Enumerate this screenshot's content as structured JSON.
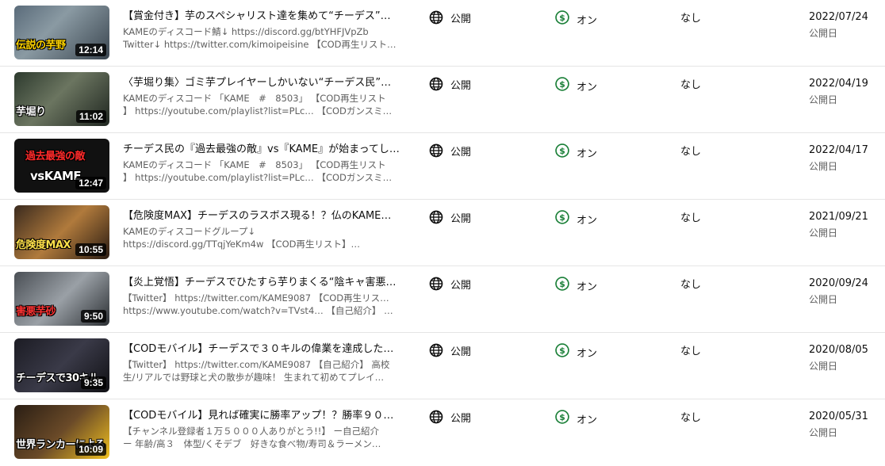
{
  "colors": {
    "monetize_green": "#1a7f37",
    "text_secondary": "#606060",
    "divider": "#e5e5e5"
  },
  "videos": [
    {
      "thumb_caption": "伝説の芋野",
      "duration": "12:14",
      "title": "【賞金付き】芋のスペシャリスト達を集めて“チーデス”を…",
      "desc1": "KAMEのディスコード鯖↓ https://discord.gg/btYHFJVpZb",
      "desc2": "Twitter↓ https://twitter.com/kimoipeisine 【COD再生リスト…",
      "visibility": "公開",
      "visibility_icon": "globe-icon",
      "monetization": "オン",
      "monetization_icon": "dollar-circle-icon",
      "restrictions": "なし",
      "date": "2022/07/24",
      "date_label": "公開日"
    },
    {
      "thumb_caption": "芋堀り",
      "duration": "11:02",
      "title": "〈芋堀り集〉ゴミ芋プレイヤーしかいない“チーデス民”を…",
      "desc1": "KAMEのディスコード 「KAME　#　8503」 【COD再生リスト",
      "desc2": "】 https://youtube.com/playlist?list=PLc… 【CODガンスミ…",
      "visibility": "公開",
      "visibility_icon": "globe-icon",
      "monetization": "オン",
      "monetization_icon": "dollar-circle-icon",
      "restrictions": "なし",
      "date": "2022/04/19",
      "date_label": "公開日"
    },
    {
      "thumb_caption": "過去最強の敵",
      "thumb_caption2": "vsKAME",
      "duration": "12:47",
      "title": "チーデス民の『過去最強の敵』vs『KAME』が始まってし…",
      "desc1": "KAMEのディスコード 「KAME　#　8503」 【COD再生リスト",
      "desc2": "】 https://youtube.com/playlist?list=PLc… 【CODガンスミ…",
      "visibility": "公開",
      "visibility_icon": "globe-icon",
      "monetization": "オン",
      "monetization_icon": "dollar-circle-icon",
      "restrictions": "なし",
      "date": "2022/04/17",
      "date_label": "公開日"
    },
    {
      "thumb_caption": "危険度MAX",
      "duration": "10:55",
      "title": "【危険度MAX】チーデスのラスボス現る！？仏のKAMEを…",
      "desc1": "KAMEのディスコードグループ↓",
      "desc2": "https://discord.gg/TTqjYeKm4w 【COD再生リスト】…",
      "visibility": "公開",
      "visibility_icon": "globe-icon",
      "monetization": "オン",
      "monetization_icon": "dollar-circle-icon",
      "restrictions": "なし",
      "date": "2021/09/21",
      "date_label": "公開日"
    },
    {
      "thumb_caption": "害悪芋砂",
      "duration": "9:50",
      "title": "【炎上覚悟】チーデスでひたすら芋りまくる“陰キャ害悪…",
      "desc1": "【Twitter】 https://twitter.com/KAME9087 【COD再生リスト】",
      "desc2": "https://www.youtube.com/watch?v=TVst4… 【自己紹介】 高…",
      "visibility": "公開",
      "visibility_icon": "globe-icon",
      "monetization": "オン",
      "monetization_icon": "dollar-circle-icon",
      "restrictions": "なし",
      "date": "2020/09/24",
      "date_label": "公開日"
    },
    {
      "thumb_caption": "チーデスで30キル",
      "duration": "9:35",
      "title": "【CODモバイル】チーデスで３０キルの偉業を達成した…",
      "desc1": "【Twitter】 https://twitter.com/KAME9087 【自己紹介】 高校",
      "desc2": "生/リアルでは野球と犬の散歩が趣味！ 生まれて初めてプレイ…",
      "visibility": "公開",
      "visibility_icon": "globe-icon",
      "monetization": "オン",
      "monetization_icon": "dollar-circle-icon",
      "restrictions": "なし",
      "date": "2020/08/05",
      "date_label": "公開日"
    },
    {
      "thumb_caption": "世界ランカーによる",
      "duration": "10:09",
      "title": "【CODモバイル】見れば確実に勝率アップ！？勝率９０…",
      "desc1": "【チャンネル登録者１万５０００人ありがとう!!】 ー自己紹介",
      "desc2": "ー 年齢/高３　体型/くそデブ　好きな食べ物/寿司＆ラーメン…",
      "visibility": "公開",
      "visibility_icon": "globe-icon",
      "monetization": "オン",
      "monetization_icon": "dollar-circle-icon",
      "restrictions": "なし",
      "date": "2020/05/31",
      "date_label": "公開日"
    }
  ]
}
